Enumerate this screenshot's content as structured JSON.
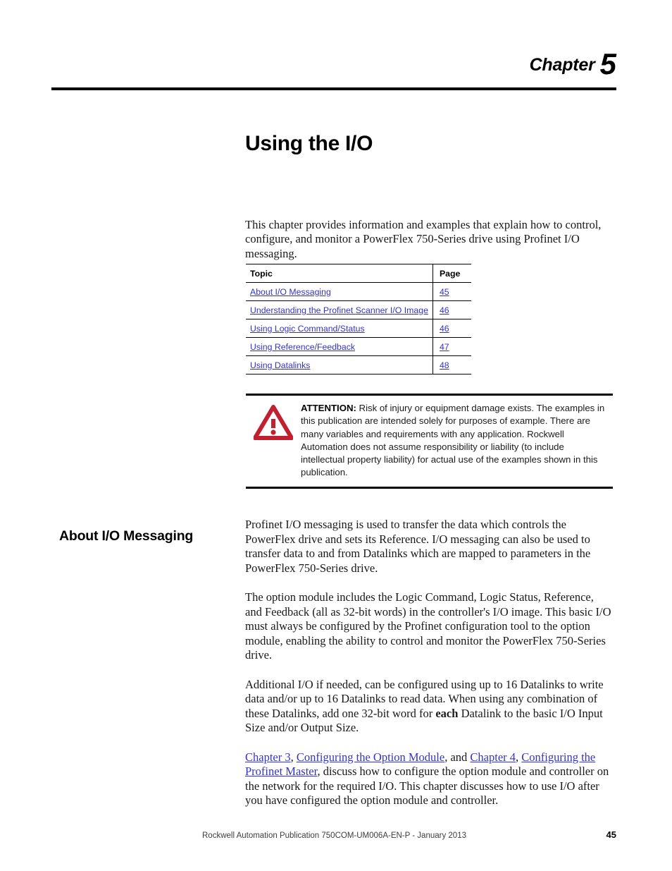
{
  "header": {
    "chapter_word": "Chapter",
    "chapter_number": "5"
  },
  "page_title": "Using the I/O",
  "intro_paragraph": "This chapter provides information and examples that explain how to control, configure, and monitor a PowerFlex 750-Series drive using Profinet I/O messaging.",
  "topic_table": {
    "columns": [
      "Topic",
      "Page"
    ],
    "rows": [
      {
        "topic": "About I/O Messaging",
        "page": "45"
      },
      {
        "topic": "Understanding the Profinet Scanner I/O Image",
        "page": "46"
      },
      {
        "topic": "Using Logic Command/Status",
        "page": "46"
      },
      {
        "topic": "Using Reference/Feedback",
        "page": "47"
      },
      {
        "topic": "Using Datalinks",
        "page": "48"
      }
    ]
  },
  "attention": {
    "icon": "warning-triangle-icon",
    "label": "ATTENTION:",
    "text": " Risk of injury or equipment damage exists. The examples in this publication are intended solely for purposes of example. There are many variables and requirements with any application. Rockwell Automation does not assume responsibility or liability (to include intellectual property liability) for actual use of the examples shown in this publication.",
    "accent_color": "#C0202F"
  },
  "section": {
    "heading": "About I/O Messaging",
    "paragraph_1": "Profinet I/O messaging is used to transfer the data which controls the PowerFlex drive and sets its Reference. I/O messaging can also be used to transfer data to and from Datalinks which are mapped to parameters in the PowerFlex 750-Series drive.",
    "paragraph_2": "The option module includes the Logic Command, Logic Status, Reference, and Feedback (all as 32-bit words) in the controller's I/O image. This basic I/O must always be configured by the Profinet configuration tool to the option module, enabling the ability to control and monitor the PowerFlex 750-Series drive.",
    "paragraph_3": {
      "part_1": "Additional I/O if needed, can be configured using up to 16 Datalinks to write data and/or up to 16 Datalinks to read data. When using any combination of these Datalinks, add one 32-bit word for ",
      "emphasis": "each",
      "part_2": " Datalink to the basic I/O Input Size and/or Output Size."
    },
    "paragraph_4": {
      "link_1": "Chapter 3",
      "sep_1": ", ",
      "link_2": "Configuring the Option Module",
      "sep_2": ", and ",
      "link_3": "Chapter 4",
      "sep_3": ", ",
      "link_4": "Configuring the Profinet Master",
      "tail": ", discuss how to configure the option module and controller on the network for the required I/O. This chapter discusses how to use I/O after you have configured the option module and controller."
    }
  },
  "footer": {
    "publication": "Rockwell Automation Publication 750COM-UM006A-EN-P - January 2013",
    "page_number": "45"
  },
  "colors": {
    "link": "#3333CC",
    "rule": "#000000",
    "attention_red": "#C0202F",
    "body_text": "#191919"
  }
}
